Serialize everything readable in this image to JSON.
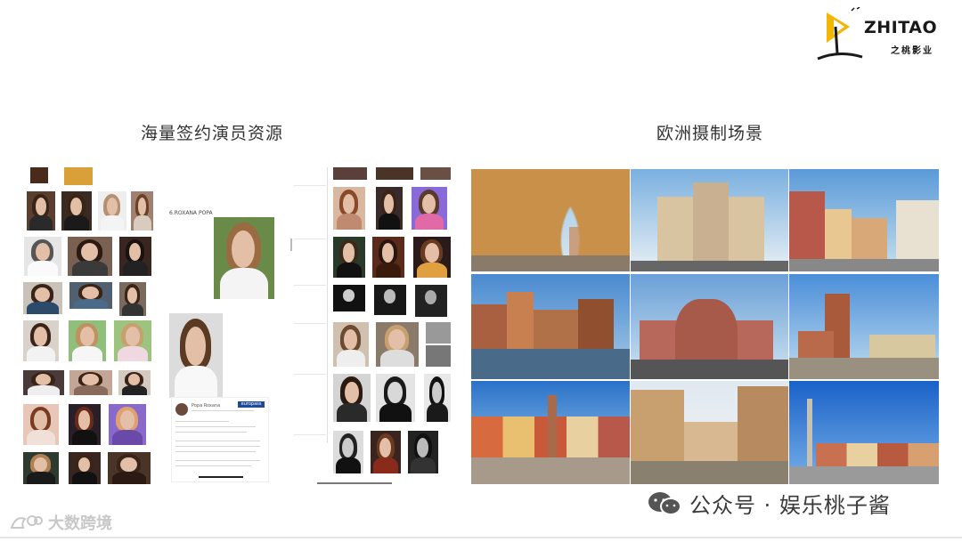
{
  "logo": {
    "name": "ZHITAO",
    "sub": "之桃影业"
  },
  "sections": {
    "left_title": "海量签约演员资源",
    "right_title": "欧洲摄制场景"
  },
  "resume": {
    "name_heading": "6.ROXANA POPA",
    "card_name": "Popa Roxana",
    "card_badge": "europass"
  },
  "watermark": {
    "account": "公众号 · 娱乐桃子酱",
    "secondary": "大数跨境"
  },
  "colors": {
    "accent_yellow": "#f2b705",
    "sky_blue": "#3e7cc4",
    "brick": "#b9583a"
  }
}
